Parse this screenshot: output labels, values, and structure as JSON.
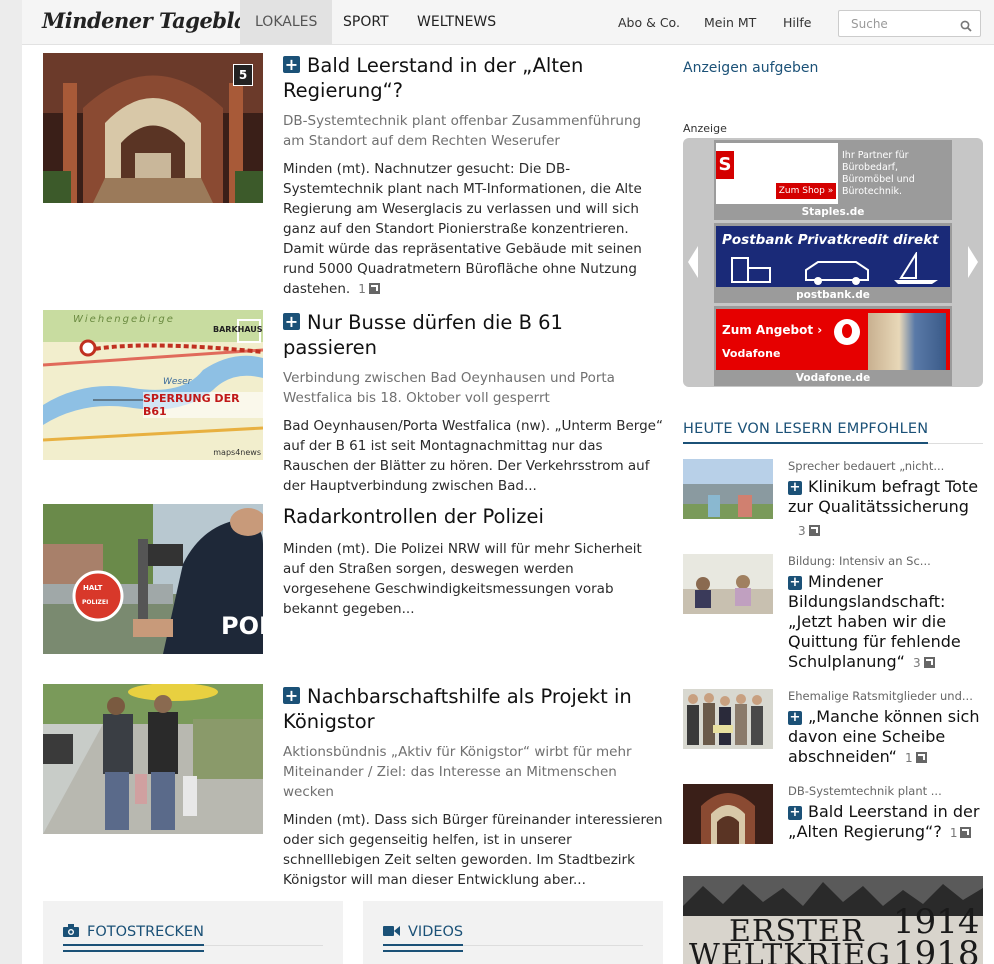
{
  "header": {
    "logo": "Mindener Tageblatt",
    "nav": [
      "LOKALES",
      "SPORT",
      "WELTNEWS"
    ],
    "links": [
      "Abo & Co.",
      "Mein MT",
      "Hilfe"
    ],
    "search_placeholder": "Suche"
  },
  "articles": [
    {
      "title": "Bald Leerstand in der „Alten Regierung“?",
      "subtitle": "DB-Systemtechnik plant offenbar Zusammenführung am Standort auf dem Rechten Weserufer",
      "text": "Minden (mt). Nachnutzer gesucht: Die DB-Systemtechnik plant nach MT-Informationen, die Alte Regierung am Weserglacis zu verlassen und will sich ganz auf den Standort Pionierstraße konzentrieren. Damit würde das repräsentative Gebäude mit seinen rund 5000 Quadratmetern Bürofläche ohne Nutzung dastehen.",
      "comments": "1",
      "gallery_count": "5"
    },
    {
      "title": "Nur Busse dürfen die B 61 passieren",
      "subtitle": "Verbindung zwischen Bad Oeynhausen und Porta Westfalica bis 18. Oktober voll gesperrt",
      "text": "Bad Oeynhausen/Porta Westfalica (nw). „Unterm Berge“ auf der B 61 ist seit Montagnachmittag nur das Rauschen der Blätter zu hören. Der Verkehrsstrom auf der Hauptverbindung zwischen Bad...",
      "map_labels": [
        "Wiehengebirge",
        "BARKHAUSEN",
        "SPERRUNG DER B61",
        "Weser",
        "maps4news"
      ]
    },
    {
      "title": "Radarkontrollen der Polizei",
      "text": "Minden (mt). Die Polizei NRW will für mehr Sicherheit auf den Straßen sorgen, deswegen werden vorgesehene Geschwindigkeitsmessungen vorab bekannt gegeben...",
      "img_text": [
        "HALT",
        "POLIZEI",
        "POL"
      ]
    },
    {
      "title": "Nachbarschaftshilfe als Projekt in Königstor",
      "subtitle": "Aktionsbündnis „Aktiv für Königstor“ wirbt für mehr Miteinander / Ziel: das Interesse an Mitmenschen wecken",
      "text": "Minden (mt). Dass sich Bürger füreinander interessieren oder sich gegenseitig helfen, ist in unserer schnelllebigen Zeit selten geworden. Im Stadtbezirk Königstor will man dieser Entwicklung aber..."
    }
  ],
  "sidebar": {
    "anzeigen_link": "Anzeigen aufgeben",
    "ad_label": "Anzeige",
    "ads": [
      {
        "caption": "Staples.de",
        "text": "Ihr Partner für Bürobedarf, Büromöbel und Bürotechnik.",
        "button": "Zum Shop »",
        "logo": "S"
      },
      {
        "caption": "postbank.de",
        "text": "Postbank Privatkredit direkt"
      },
      {
        "caption": "Vodafone.de",
        "text": "Zum Angebot ›",
        "brand": "Vodafone"
      }
    ],
    "recommended_heading": "HEUTE VON LESERN EMPFOHLEN",
    "recommended": [
      {
        "tag": "Sprecher bedauert „nicht...",
        "title": "Klinikum befragt Tote zur Qualitätssicherung",
        "comments": "3"
      },
      {
        "tag": "Bildung: Intensiv an Sc...",
        "title": "Mindener Bildungslandschaft: „Jetzt haben wir die Quittung für fehlende Schulplanung“",
        "comments": "3"
      },
      {
        "tag": "Ehemalige Ratsmitglieder und...",
        "title": "„Manche können sich davon eine Scheibe abschneiden“",
        "comments": "1"
      },
      {
        "tag": "DB-Systemtechnik plant ...",
        "title": "Bald Leerstand in der „Alten Regierung“?",
        "comments": "1"
      }
    ],
    "banner": [
      "ERSTER",
      "WELTKRIEG",
      "1914",
      "1918"
    ]
  },
  "bottom": {
    "fotostrecken": "FOTOSTRECKEN",
    "videos": "VIDEOS"
  },
  "colors": {
    "accent": "#1b5177"
  }
}
